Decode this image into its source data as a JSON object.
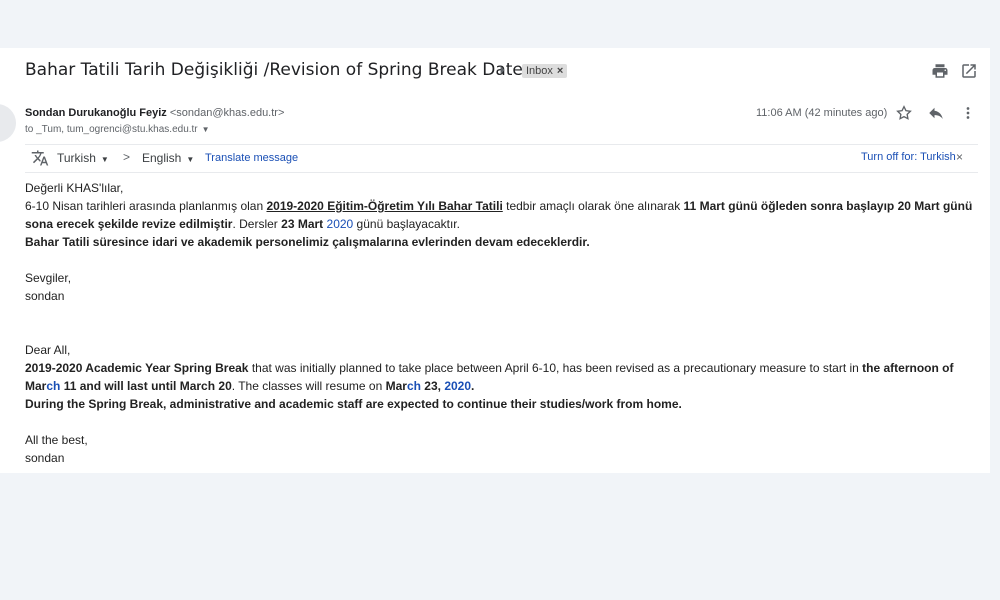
{
  "header": {
    "subject": "Bahar Tatili Tarih Değişikliği /Revision of Spring Break Dates",
    "label": "Inbox",
    "icons": [
      "importance-marker-icon",
      "print-icon",
      "open-in-new-window-icon"
    ]
  },
  "sender": {
    "name": "Sondan Durukanoğlu Feyiz",
    "email": "<sondan@khas.edu.tr>",
    "to": "to _Tum, tum_ogrenci@stu.khas.edu.tr",
    "time": "11:06 AM (42 minutes ago)",
    "icons": [
      "star-icon",
      "reply-icon",
      "more-vert-icon"
    ]
  },
  "translate": {
    "source_lang": "Turkish",
    "target_lang": "English",
    "translate_label": "Translate message",
    "turn_off_label": "Turn off for: Turkish"
  },
  "body": {
    "tr_greeting": "Değerli KHAS'lılar,",
    "tr_p1_a": "6-10 Nisan tarihleri arasında planlanmış olan ",
    "tr_p1_b": "2019-2020 Eğitim-Öğretim Yılı Bahar Tatili",
    "tr_p1_c": " tedbir amaçlı olarak öne alınarak ",
    "tr_p1_d": "11 Mart günü öğleden sonra başlayıp 20 Mart günü sona erecek şekilde revize edilmiştir",
    "tr_p1_e": ". Dersler ",
    "tr_p1_f": "23 Mart",
    "tr_p1_g": " ",
    "tr_p1_h": "2020",
    "tr_p1_i": " günü başlayacaktır.",
    "tr_p2": "Bahar Tatili süresince idari ve akademik personelimiz çalışmalarına evlerinden devam edeceklerdir.",
    "tr_sign1": "Sevgiler,",
    "tr_sign2": "sondan",
    "en_greeting": "Dear All,",
    "en_p1_a": "2019-2020 Academic Year Spring Break",
    "en_p1_b": " that was initially planned to take place between April 6-10, has been revised as a precautionary measure to start in ",
    "en_p1_c": "the afternoon of Mar",
    "en_p1_d": "ch",
    "en_p1_e": " 11 and will last until March 20",
    "en_p1_f": ". The classes will resume on ",
    "en_p1_g": "Mar",
    "en_p1_h": "ch",
    "en_p1_i": " 23, ",
    "en_p1_j": "2020",
    "en_p1_k": ".",
    "en_p2": "During the Spring Break,  administrative and academic staff are expected to continue their studies/work from home.",
    "en_sign1": "All the best,",
    "en_sign2": "sondan"
  }
}
